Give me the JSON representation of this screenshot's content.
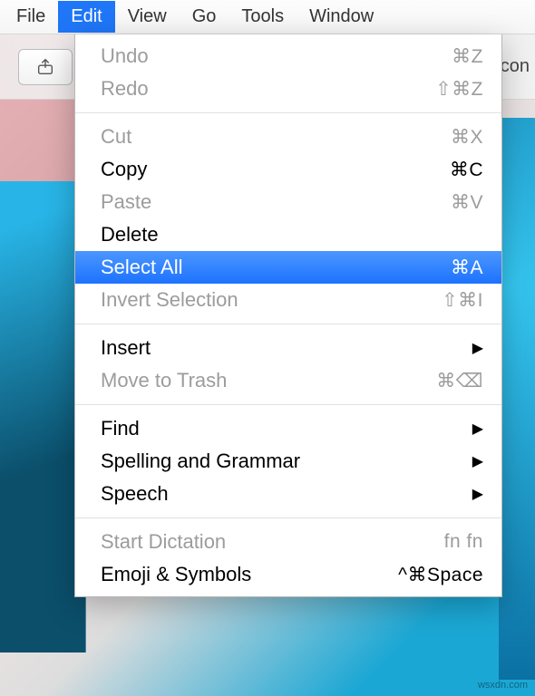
{
  "menubar": {
    "items": [
      {
        "label": "File",
        "active": false
      },
      {
        "label": "Edit",
        "active": true
      },
      {
        "label": "View",
        "active": false
      },
      {
        "label": "Go",
        "active": false
      },
      {
        "label": "Tools",
        "active": false
      },
      {
        "label": "Window",
        "active": false
      }
    ]
  },
  "toolbar": {
    "right_hint": "con"
  },
  "dropdown": {
    "groups": [
      [
        {
          "label": "Undo",
          "shortcut": "⌘Z",
          "enabled": false
        },
        {
          "label": "Redo",
          "shortcut": "⇧⌘Z",
          "enabled": false
        }
      ],
      [
        {
          "label": "Cut",
          "shortcut": "⌘X",
          "enabled": false
        },
        {
          "label": "Copy",
          "shortcut": "⌘C",
          "enabled": true
        },
        {
          "label": "Paste",
          "shortcut": "⌘V",
          "enabled": false
        },
        {
          "label": "Delete",
          "shortcut": "",
          "enabled": true
        },
        {
          "label": "Select All",
          "shortcut": "⌘A",
          "enabled": true,
          "highlight": true
        },
        {
          "label": "Invert Selection",
          "shortcut": "⇧⌘I",
          "enabled": false
        }
      ],
      [
        {
          "label": "Insert",
          "submenu": true,
          "enabled": true
        },
        {
          "label": "Move to Trash",
          "shortcut": "⌘⌫",
          "enabled": false
        }
      ],
      [
        {
          "label": "Find",
          "submenu": true,
          "enabled": true
        },
        {
          "label": "Spelling and Grammar",
          "submenu": true,
          "enabled": true
        },
        {
          "label": "Speech",
          "submenu": true,
          "enabled": true
        }
      ],
      [
        {
          "label": "Start Dictation",
          "shortcut": "fn fn",
          "enabled": false
        },
        {
          "label": "Emoji & Symbols",
          "shortcut": "^⌘Space",
          "enabled": true
        }
      ]
    ]
  },
  "watermark": "wsxdn.com"
}
